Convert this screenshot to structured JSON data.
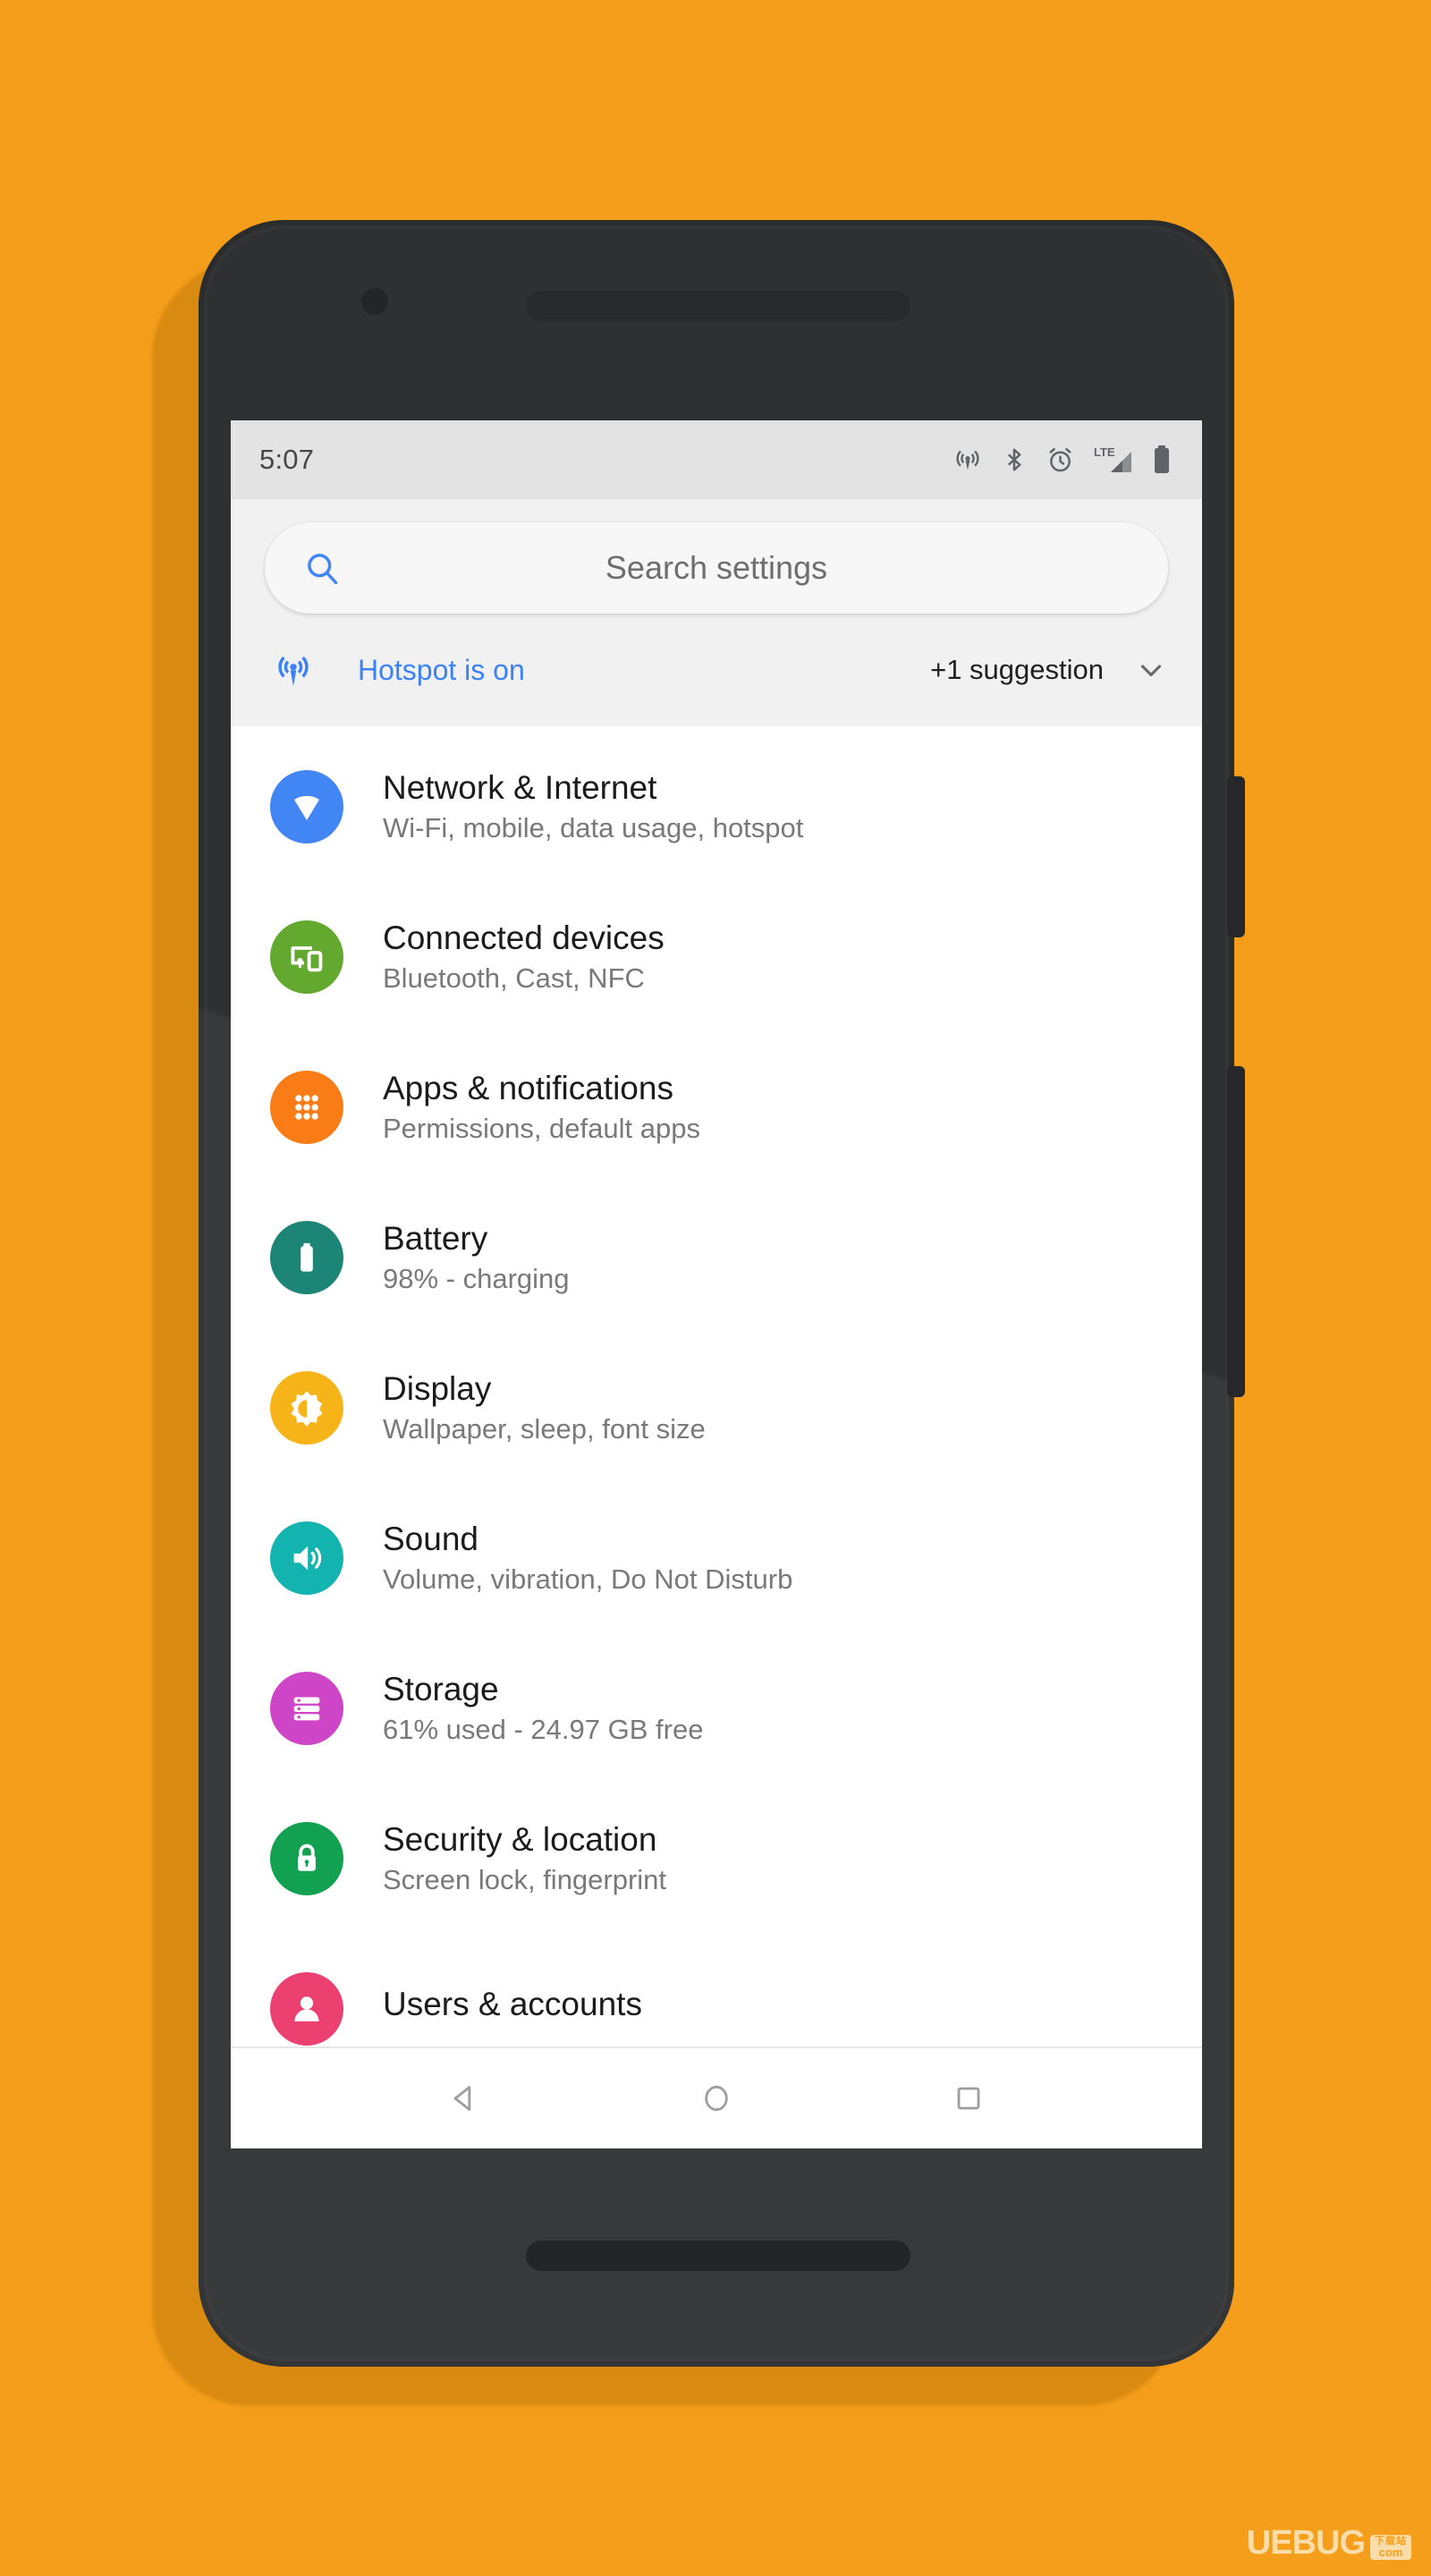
{
  "background": {
    "color": "#F59E1B"
  },
  "device": {
    "body_color": "#333436",
    "camera_icon": "camera-dot",
    "speaker_icon": "speaker-grille",
    "power_button": "power-button",
    "volume_button": "volume-button"
  },
  "statusbar": {
    "time": "5:07",
    "icons": [
      {
        "name": "hotspot-icon"
      },
      {
        "name": "bluetooth-icon"
      },
      {
        "name": "alarm-icon"
      },
      {
        "name": "lte-signal-icon",
        "label": "LTE"
      },
      {
        "name": "battery-icon"
      }
    ]
  },
  "search": {
    "placeholder": "Search settings",
    "icon": "search-icon",
    "icon_color": "#4285F4"
  },
  "suggestion": {
    "icon": "hotspot-icon",
    "label": "Hotspot is on",
    "label_color": "#3b82f6",
    "count_label": "+1 suggestion",
    "expand_icon": "chevron-down-icon"
  },
  "settings": {
    "items": [
      {
        "title": "Network & Internet",
        "subtitle": "Wi-Fi, mobile, data usage, hotspot",
        "icon": "wifi-icon",
        "color": "#4285F4"
      },
      {
        "title": "Connected devices",
        "subtitle": "Bluetooth, Cast, NFC",
        "icon": "devices-icon",
        "color": "#63A92F"
      },
      {
        "title": "Apps & notifications",
        "subtitle": "Permissions, default apps",
        "icon": "apps-grid-icon",
        "color": "#F97C16"
      },
      {
        "title": "Battery",
        "subtitle": "98% - charging",
        "icon": "battery-icon",
        "color": "#1D8576"
      },
      {
        "title": "Display",
        "subtitle": "Wallpaper, sleep, font size",
        "icon": "brightness-icon",
        "color": "#F7B418"
      },
      {
        "title": "Sound",
        "subtitle": "Volume, vibration, Do Not Disturb",
        "icon": "volume-icon",
        "color": "#13B3B0"
      },
      {
        "title": "Storage",
        "subtitle": "61% used - 24.97 GB free",
        "icon": "storage-icon",
        "color": "#CF45C8"
      },
      {
        "title": "Security & location",
        "subtitle": "Screen lock, fingerprint",
        "icon": "lock-icon",
        "color": "#12A150"
      },
      {
        "title": "Users & accounts",
        "subtitle": "",
        "icon": "account-icon",
        "color": "#EC4071"
      }
    ]
  },
  "navbar": {
    "back": "back-icon",
    "home": "home-icon",
    "recents": "recents-icon"
  },
  "watermark": {
    "text": "UEBUG",
    "badge_top": "下载站",
    "badge_bottom": "com"
  }
}
